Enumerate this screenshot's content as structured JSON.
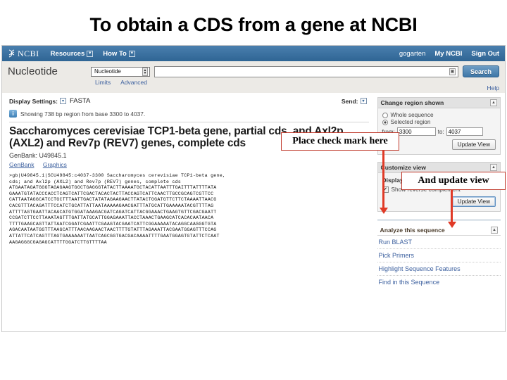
{
  "slide": {
    "title": "To obtain a CDS from a gene at NCBI"
  },
  "topbar": {
    "logo_text": "NCBI",
    "items": [
      {
        "label": "Resources",
        "caret": "chevron-down-icon"
      },
      {
        "label": "How To",
        "caret": "chevron-down-icon"
      }
    ],
    "user": "gogarten",
    "my_ncbi": "My NCBI",
    "sign_out": "Sign Out"
  },
  "search": {
    "database_title": "Nucleotide",
    "database_selected": "Nucleotide",
    "query_value": "",
    "search_button": "Search",
    "limits_link": "Limits",
    "advanced_link": "Advanced",
    "help_link": "Help"
  },
  "toolbar": {
    "display_settings_label": "Display Settings:",
    "display_settings_value": "FASTA",
    "send_label": "Send:"
  },
  "notice": {
    "text": "Showing 738 bp region from base 3300 to 4037."
  },
  "record": {
    "title": "Saccharomyces cerevisiae TCP1-beta gene, partial cds, and Axl2p (AXL2) and Rev7p (REV7) genes, complete cds",
    "accession": "GenBank: U49845.1",
    "format_links": [
      "GenBank",
      "Graphics"
    ]
  },
  "sequence": {
    "defline_1": ">gb|U49845.1|SCU49845:c4037-3300 Saccharomyces cerevisiae TCP1-beta gene,",
    "defline_2": "cds; and Axl2p (AXL2) and Rev7p (REV7) genes, complete cds",
    "lines": [
      "ATGAATAGATGGGTAGAGAAGTGGCTGAGGGTATACTTAAAATGCTACATTAATTTGAITTTATTTTATA",
      "GAAATGTATACCCACCTCAGTCATTCGACTACACTACTTACCAGTCATTCAACTTGCCGCAGTCGTTCC",
      "CATTAATAGGCATCCTGCTTTAATTGACTATATAGAAGAACTTATACTGGATGTTCTTCTAAAATTAACG",
      "CACGTTTACAGATTTCCATCTGCATTATTAATAAAAAGAACGATTTATGCATTGAAAAATACGTTTTAG",
      "ATTTTAGTGAATTACAACATGTGGATAAAGACGATCAGATCATTACGGAAACTGAAGTGTTCGACGAATT",
      "CCGATCTTCCTTAAATAGTTTGATTATGCATTGGAGAAATTACCTAAACTGAAGCATCACACAATAACA",
      "TTTTGAAGCAGTTATTAATCGGATCGAATTCGAAGTACGAATCATTCGGAAAAATACAGGCAAGGGTGTA",
      "AGACAATAATGGTTTAAGCATTTAACAAGAACTAACTTTTGTATTTAGAAATTACGAATGGAGTTTCCAG",
      "ATTATTCATCAGTTTAGTGAAAAAATTAATCAGCGGTGACGACAAAATTTTGAATGGAGTGTATTCTCAAT",
      "AAGAGGGCGAGAGCATTTTGGATCTTGTTTTAA"
    ]
  },
  "sidebar": {
    "change_region": {
      "title": "Change region shown",
      "collapse_icon": "collapse-icon",
      "option_whole": "Whole sequence",
      "option_selected": "Selected region",
      "from_label": "from:",
      "from_value": "3300",
      "to_label": "to:",
      "to_value": "4037",
      "update_button": "Update View"
    },
    "customize_view": {
      "title": "Customize view",
      "collapse_icon": "collapse-icon",
      "section_label": "Display options",
      "checkbox_label": "Show reverse complement",
      "checkbox_checked": true,
      "update_button": "Update View"
    },
    "analyze": {
      "title": "Analyze this sequence",
      "collapse_icon": "collapse-icon",
      "links": [
        "Run BLAST",
        "Pick Primers",
        "Highlight Sequence Features",
        "Find in this Sequence"
      ]
    }
  },
  "annotations": {
    "check_mark": "Place check mark here",
    "update_view": "And update view",
    "accent_color": "#e03a27"
  }
}
